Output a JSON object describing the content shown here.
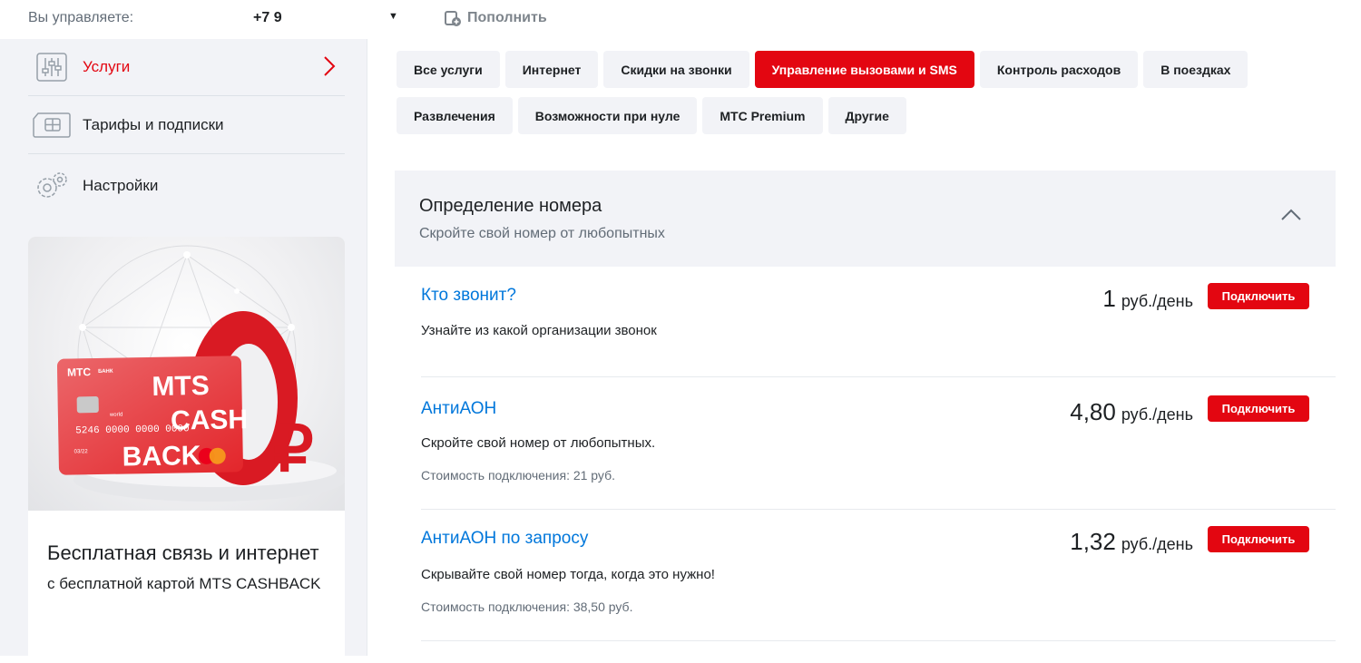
{
  "topbar": {
    "manage_label": "Вы управляете:",
    "phone": "+7 9",
    "topup_label": "Пополнить"
  },
  "sidebar": {
    "items": [
      {
        "label": "Услуги",
        "icon": "sliders-icon",
        "active": true
      },
      {
        "label": "Тарифы и подписки",
        "icon": "sim-card-icon",
        "active": false
      },
      {
        "label": "Настройки",
        "icon": "gear-icon",
        "active": false
      }
    ],
    "promo": {
      "card_brand": "МТС",
      "card_bank": "БАНК",
      "card_title_1": "MTS",
      "card_title_2": "CASH",
      "card_title_3": "BACK",
      "card_world": "world",
      "card_number": "5246 0000 0000 0000",
      "card_valid": "03/22",
      "title": "Бесплатная связь и интернет",
      "subtitle": "с бесплатной картой MTS CASHBACK"
    }
  },
  "filters": {
    "row1": [
      "Все услуги",
      "Интернет",
      "Скидки на звонки",
      "Управление вызовами и SMS",
      "Контроль расходов",
      "В поездках"
    ],
    "row2": [
      "Развлечения",
      "Возможности при нуле",
      "МТС Premium",
      "Другие"
    ],
    "active": "Управление вызовами и SMS"
  },
  "section": {
    "title": "Определение номера",
    "subtitle": "Скройте свой номер от любопытных"
  },
  "services": [
    {
      "name": "Кто звонит?",
      "desc": "Узнайте из какой организации звонок",
      "cost": "",
      "price": "1",
      "unit": "руб./день",
      "button": "Подключить"
    },
    {
      "name": "АнтиАОН",
      "desc": "Скройте свой номер от любопытных.",
      "cost": "Стоимость подключения: 21 руб.",
      "price": "4,80",
      "unit": "руб./день",
      "button": "Подключить"
    },
    {
      "name": "АнтиАОН по запросу",
      "desc": "Скрывайте свой номер тогда, когда это нужно!",
      "cost": "Стоимость подключения: 38,50 руб.",
      "price": "1,32",
      "unit": "руб./день",
      "button": "Подключить"
    }
  ],
  "colors": {
    "accent": "#e30611",
    "link": "#0077db",
    "panel": "#f2f3f7"
  }
}
